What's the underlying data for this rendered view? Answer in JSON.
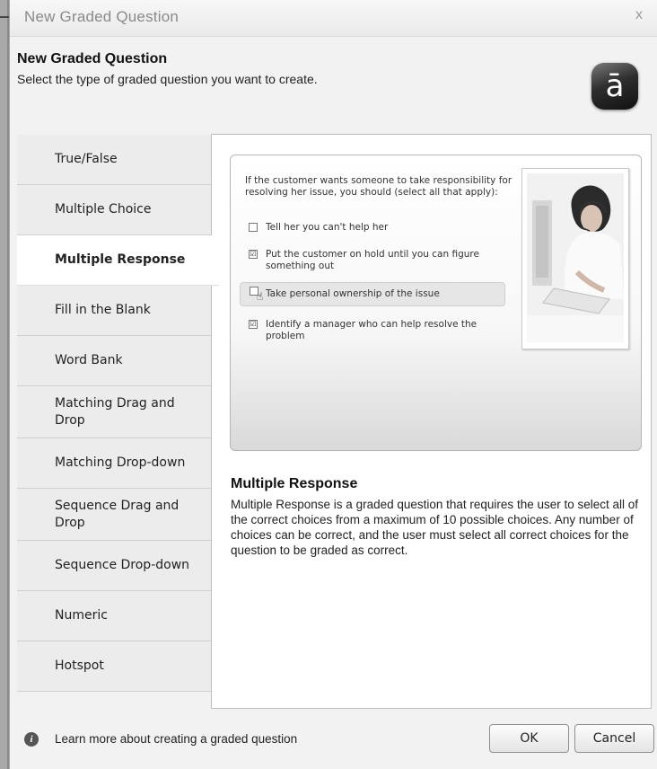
{
  "window": {
    "title": "New Graded Question",
    "close_label": "x"
  },
  "header": {
    "heading": "New Graded Question",
    "subtitle": "Select the type of graded question you want to create.",
    "logo_glyph": "ā"
  },
  "sidebar": {
    "selected": "Multiple Response",
    "items": [
      {
        "label": "True/False"
      },
      {
        "label": "Multiple Choice"
      },
      {
        "label": "Multiple Response"
      },
      {
        "label": "Fill in the Blank"
      },
      {
        "label": "Word Bank"
      },
      {
        "label": "Matching Drag and Drop"
      },
      {
        "label": "Matching Drop-down"
      },
      {
        "label": "Sequence Drag and Drop"
      },
      {
        "label": "Sequence Drop-down"
      },
      {
        "label": "Numeric"
      },
      {
        "label": "Hotspot"
      }
    ]
  },
  "preview": {
    "question": "If the customer wants someone to take responsibility for resolving her issue, you should (select all that apply):",
    "choices": [
      {
        "label": "Tell her you can't help her",
        "checked": false
      },
      {
        "label": "Put the customer on hold until you can figure something out",
        "checked": true
      },
      {
        "label": "Take personal ownership of the issue",
        "checked": false,
        "highlighted": true
      },
      {
        "label": "Identify a manager who can help resolve the problem",
        "checked": true
      }
    ],
    "check_glyph": "☑",
    "image": "woman-with-headset-at-computer"
  },
  "description": {
    "title": "Multiple Response",
    "body": "Multiple Response is a graded question that requires the user to select all of the correct choices from a maximum of 10 possible choices.  Any number of choices can be correct, and the user must select all correct choices for the question to be graded as correct."
  },
  "footer": {
    "info_icon": "info-icon",
    "info_glyph": "i",
    "learn_more": "Learn more about creating a graded question",
    "ok_label": "OK",
    "cancel_label": "Cancel"
  },
  "colors": {
    "selected_tab": "#ffffff",
    "tab_bg": "#ececec",
    "dialog_bg": "#f2f2f2"
  }
}
